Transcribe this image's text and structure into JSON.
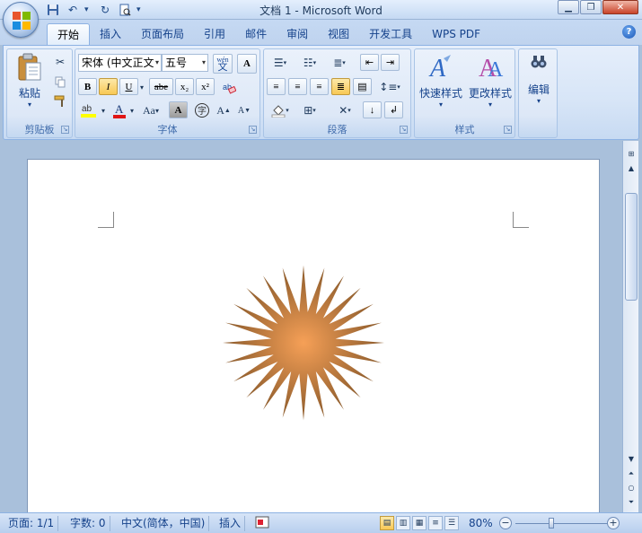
{
  "window": {
    "title": "文档 1 - Microsoft Word",
    "min_icon": "minimize-icon",
    "max_icon": "restore-icon",
    "close_icon": "close-icon"
  },
  "quick_access": [
    "save-icon",
    "undo-icon",
    "redo-icon",
    "print-preview-icon",
    "customize-dropdown-icon"
  ],
  "tabs": [
    {
      "label": "开始",
      "active": true
    },
    {
      "label": "插入"
    },
    {
      "label": "页面布局"
    },
    {
      "label": "引用"
    },
    {
      "label": "邮件"
    },
    {
      "label": "审阅"
    },
    {
      "label": "视图"
    },
    {
      "label": "开发工具"
    },
    {
      "label": "WPS PDF"
    }
  ],
  "help_label": "?",
  "ribbon": {
    "clipboard": {
      "label": "剪贴板",
      "paste": "粘贴"
    },
    "font": {
      "label": "字体",
      "font_name": "宋体 (中文正文)",
      "font_size": "五号",
      "bold": "B",
      "italic": "I",
      "underline": "U",
      "strike": "abe",
      "subscript": "x₂",
      "superscript": "x²",
      "phonetic": "wén",
      "char_border": "A",
      "case": "Aa",
      "grow": "A",
      "shrink": "A",
      "font_color_hex": "#e01515",
      "highlight_hex": "#ffff00"
    },
    "paragraph": {
      "label": "段落"
    },
    "styles": {
      "label": "样式",
      "quick": "快速样式",
      "change": "更改样式"
    },
    "editing": {
      "label": "编辑"
    }
  },
  "statusbar": {
    "page": "页面: 1/1",
    "words": "字数: 0",
    "language": "中文(简体，中国)",
    "mode": "插入",
    "zoom": "80%",
    "zoom_fraction": 0.36
  },
  "document": {
    "shape": "24-point-star",
    "shape_fill_center_hex": "#f6a057",
    "shape_fill_edge_hex": "#8a5a2b"
  }
}
